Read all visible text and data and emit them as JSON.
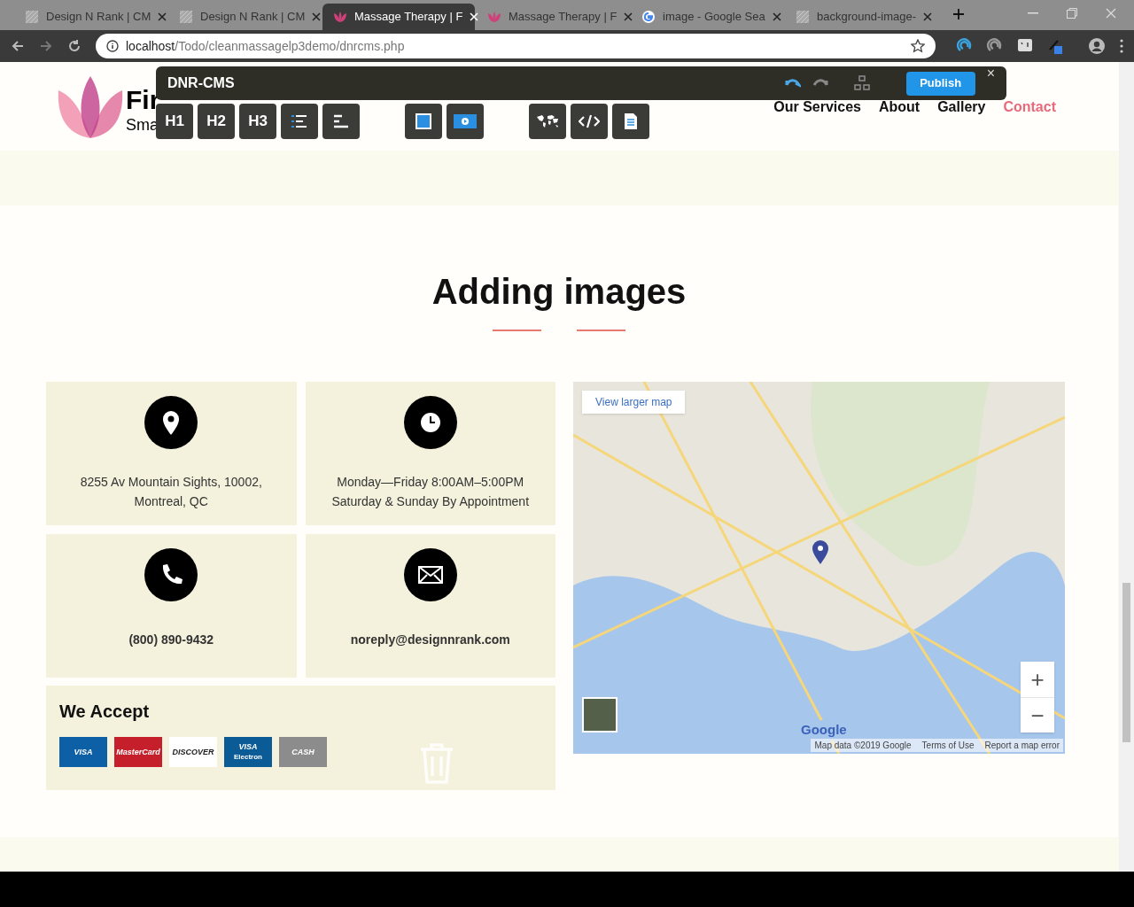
{
  "browser": {
    "tabs": [
      {
        "title": "Design N Rank | CM",
        "selected": false,
        "kind": "pattern"
      },
      {
        "title": "Design N Rank | CM",
        "selected": false,
        "kind": "pattern"
      },
      {
        "title": "Massage Therapy | F",
        "selected": true,
        "kind": "lotus"
      },
      {
        "title": "Massage Therapy | F",
        "selected": false,
        "kind": "lotus"
      },
      {
        "title": "image - Google Sea",
        "selected": false,
        "kind": "google"
      },
      {
        "title": "background-image-",
        "selected": false,
        "kind": "pattern"
      }
    ],
    "url_host": "localhost",
    "url_path": "/Todo/cleanmassagelp3demo/dnrcms.php"
  },
  "site": {
    "title": "Fir",
    "tagline": "Sma",
    "nav": [
      {
        "label": "Our Services",
        "selected": false
      },
      {
        "label": "About",
        "selected": false
      },
      {
        "label": "Gallery",
        "selected": false
      },
      {
        "label": "Contact",
        "selected": true
      }
    ]
  },
  "cms": {
    "title": "DNR-CMS",
    "publish": "Publish",
    "close": "×",
    "tools": [
      {
        "label": "H1",
        "kind": "text"
      },
      {
        "label": "H2",
        "kind": "text"
      },
      {
        "label": "H3",
        "kind": "text"
      },
      {
        "kind": "list"
      },
      {
        "kind": "align"
      },
      {
        "kind": "gap"
      },
      {
        "kind": "image"
      },
      {
        "kind": "video"
      },
      {
        "kind": "gap"
      },
      {
        "kind": "map"
      },
      {
        "kind": "code"
      },
      {
        "kind": "document"
      }
    ]
  },
  "section": {
    "heading": "Adding images",
    "contacts": [
      {
        "kind": "pin",
        "lines": [
          "8255 Av Mountain Sights, 10002,",
          "Montreal, QC"
        ]
      },
      {
        "kind": "clock",
        "lines": [
          "Monday—Friday 8:00AM–5:00PM",
          "Saturday & Sunday By Appointment"
        ]
      },
      {
        "kind": "phone",
        "lines": [
          "(800) 890-9432"
        ]
      },
      {
        "kind": "mail",
        "lines": [
          "noreply@designnrank.com"
        ]
      }
    ],
    "accept": {
      "title": "We Accept",
      "cards": [
        {
          "label": "VISA",
          "color": "#0d5fa6"
        },
        {
          "label": "MasterCard",
          "color": "#c41f2b"
        },
        {
          "label": "DISCOVER",
          "color": "#ffffff"
        },
        {
          "label": "VISA",
          "sub": "Electron",
          "color": "#0b5c96"
        },
        {
          "label": "CASH",
          "color": "#8c8c8c"
        }
      ]
    },
    "map": {
      "larger": "View larger map",
      "logo": "Google",
      "attribution": "Map data ©2019 Google",
      "terms": "Terms of Use",
      "report": "Report a map error",
      "zoom_in": "+",
      "zoom_out": "−"
    }
  }
}
